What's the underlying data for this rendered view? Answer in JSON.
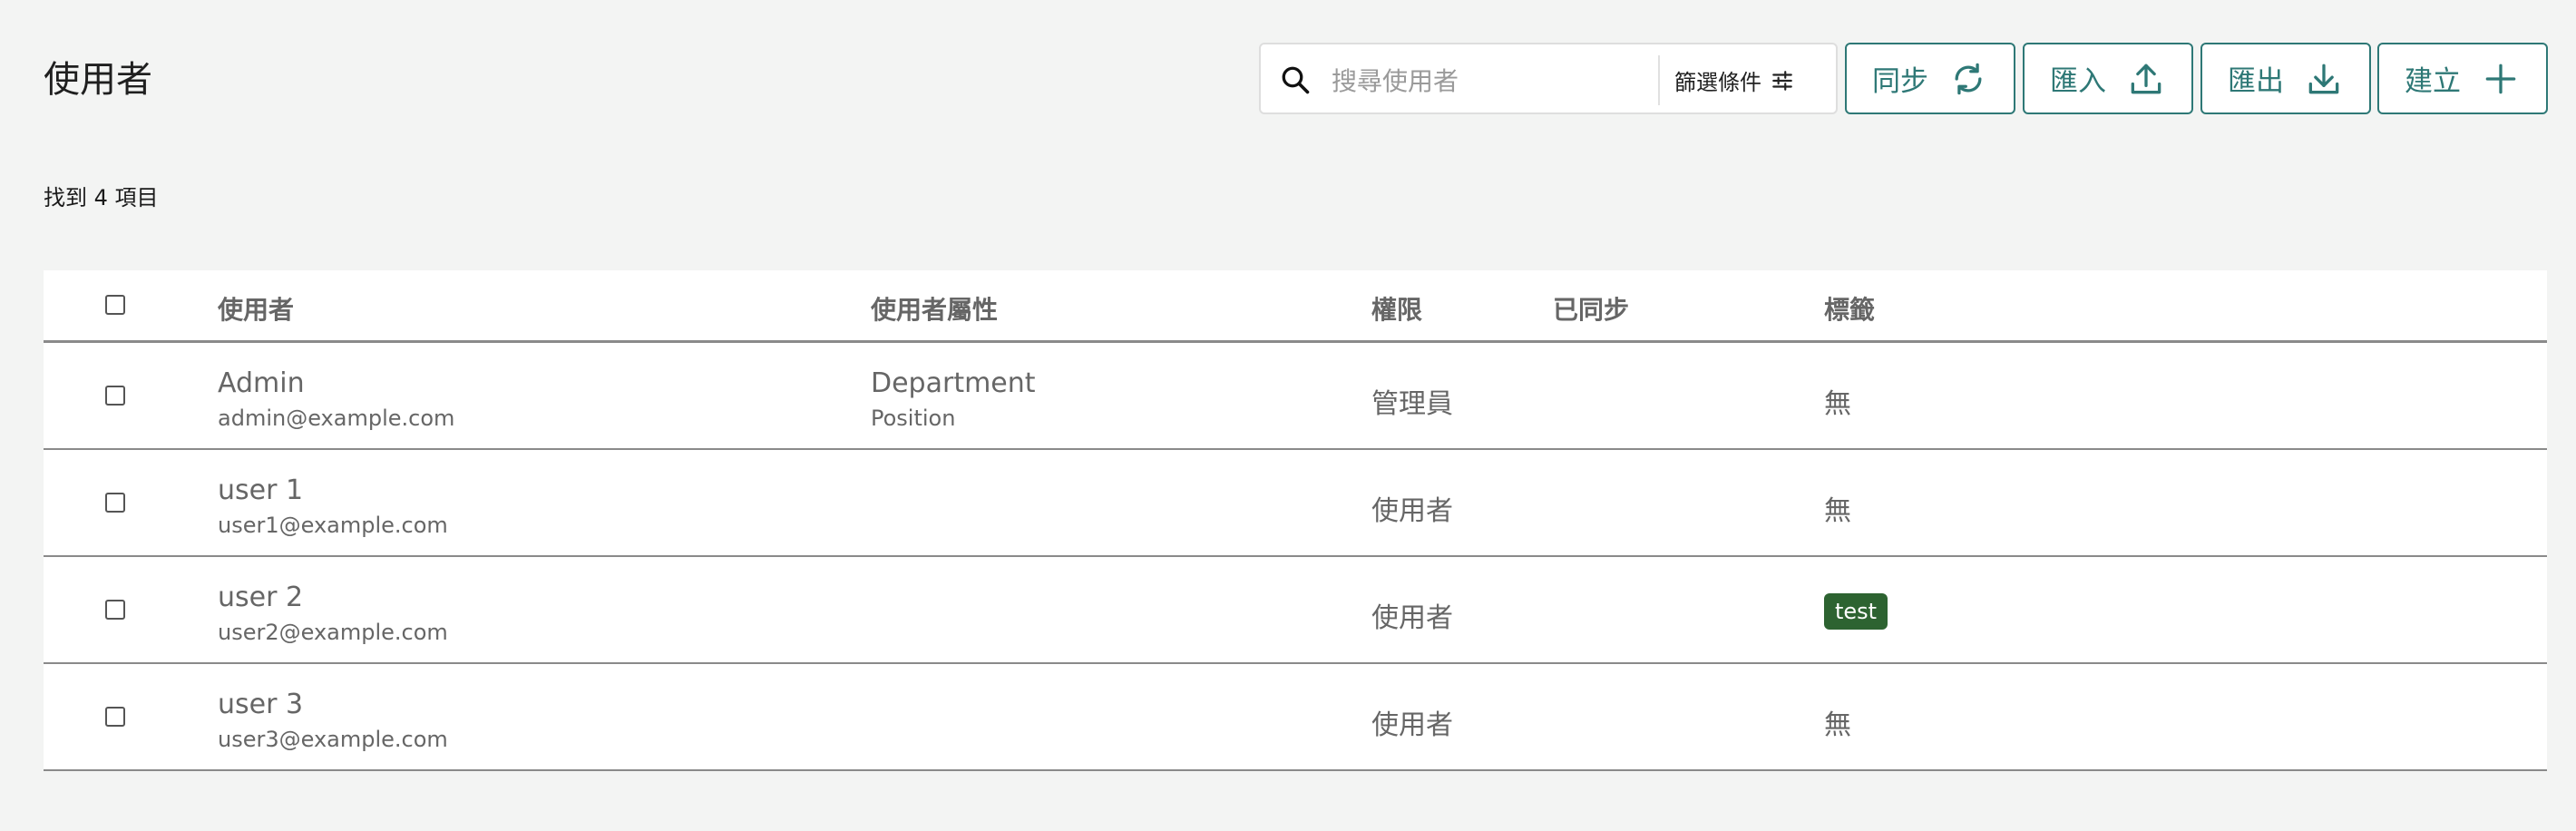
{
  "page": {
    "title": "使用者",
    "found_count": "找到 4 項目"
  },
  "search": {
    "placeholder": "搜尋使用者",
    "value": ""
  },
  "toolbar": {
    "filter_label": "篩選條件",
    "sync_label": "同步",
    "import_label": "匯入",
    "export_label": "匯出",
    "create_label": "建立",
    "accent_color": "#2e7876"
  },
  "table": {
    "headers": {
      "user": "使用者",
      "attributes": "使用者屬性",
      "role": "權限",
      "synced": "已同步",
      "tags": "標籤"
    },
    "rows": [
      {
        "name": "Admin",
        "email": "admin@example.com",
        "attr_main": "Department",
        "attr_sub": "Position",
        "role": "管理員",
        "synced": "",
        "tag": "無",
        "tag_is_badge": false
      },
      {
        "name": "user 1",
        "email": "user1@example.com",
        "attr_main": "",
        "attr_sub": "",
        "role": "使用者",
        "synced": "",
        "tag": "無",
        "tag_is_badge": false
      },
      {
        "name": "user 2",
        "email": "user2@example.com",
        "attr_main": "",
        "attr_sub": "",
        "role": "使用者",
        "synced": "",
        "tag": "test",
        "tag_is_badge": true
      },
      {
        "name": "user 3",
        "email": "user3@example.com",
        "attr_main": "",
        "attr_sub": "",
        "role": "使用者",
        "synced": "",
        "tag": "無",
        "tag_is_badge": false
      }
    ],
    "badge_color": "#2d6331"
  }
}
